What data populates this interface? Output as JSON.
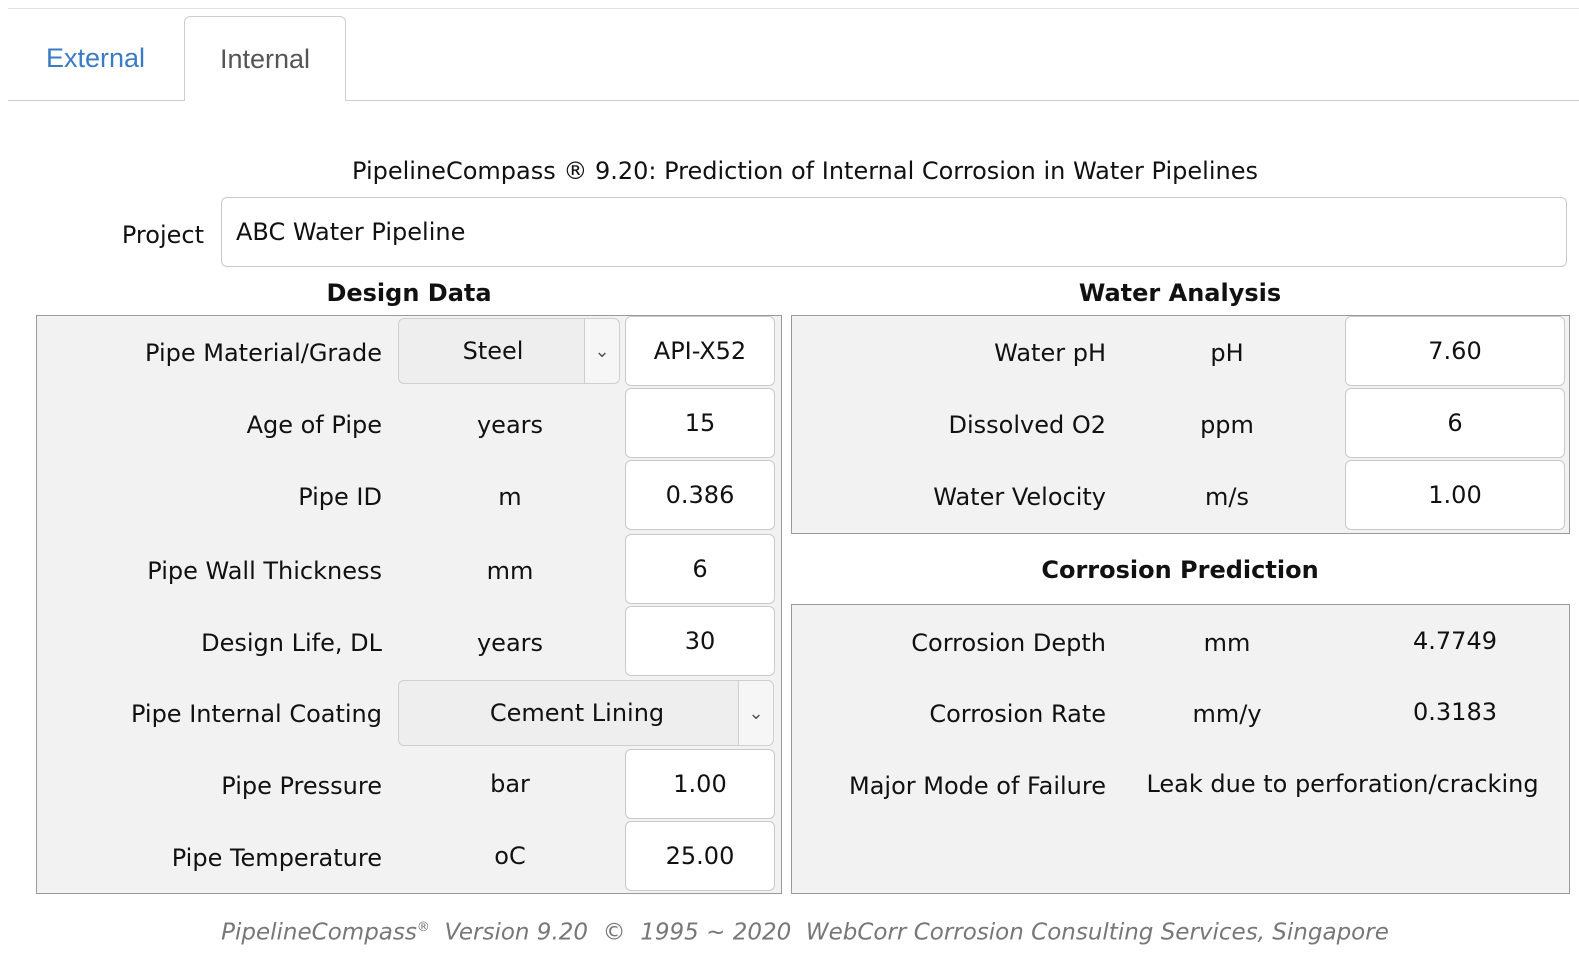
{
  "tabs": [
    {
      "label": "External"
    },
    {
      "label": "Internal"
    }
  ],
  "title": "PipelineCompass ® 9.20: Prediction of Internal Corrosion in Water Pipelines",
  "project": {
    "label": "Project",
    "value": "ABC Water Pipeline"
  },
  "design": {
    "heading": "Design Data",
    "rows": [
      {
        "label": "Pipe Material/Grade",
        "select": "Steel",
        "value": "API-X52"
      },
      {
        "label": "Age of Pipe",
        "unit": "years",
        "value": "15"
      },
      {
        "label": "Pipe ID",
        "unit": "m",
        "value": "0.386"
      },
      {
        "label": "Pipe Wall Thickness",
        "unit": "mm",
        "value": "6"
      },
      {
        "label": "Design Life, DL",
        "unit": "years",
        "value": "30"
      },
      {
        "label": "Pipe Internal Coating",
        "select": "Cement Lining"
      },
      {
        "label": "Pipe Pressure",
        "unit": "bar",
        "value": "1.00"
      },
      {
        "label": "Pipe Temperature",
        "unit": "oC",
        "value": "25.00"
      }
    ]
  },
  "water": {
    "heading": "Water Analysis",
    "rows": [
      {
        "label": "Water pH",
        "unit": "pH",
        "value": "7.60"
      },
      {
        "label": "Dissolved O2",
        "unit": "ppm",
        "value": "6"
      },
      {
        "label": "Water Velocity",
        "unit": "m/s",
        "value": "1.00"
      }
    ]
  },
  "prediction": {
    "heading": "Corrosion Prediction",
    "rows": [
      {
        "label": "Corrosion Depth",
        "unit": "mm",
        "value": "4.7749"
      },
      {
        "label": "Corrosion Rate",
        "unit": "mm/y",
        "value": "0.3183"
      },
      {
        "label": "Major Mode of Failure",
        "value": "Leak due to perforation/cracking"
      }
    ]
  },
  "footer": {
    "brand": "PipelineCompass",
    "reg": "®",
    "rest": "  Version 9.20  ©  1995 ~ 2020  WebCorr Corrosion Consulting Services, Singapore"
  },
  "icons": {
    "dropdown": "chevron-down-icon"
  }
}
